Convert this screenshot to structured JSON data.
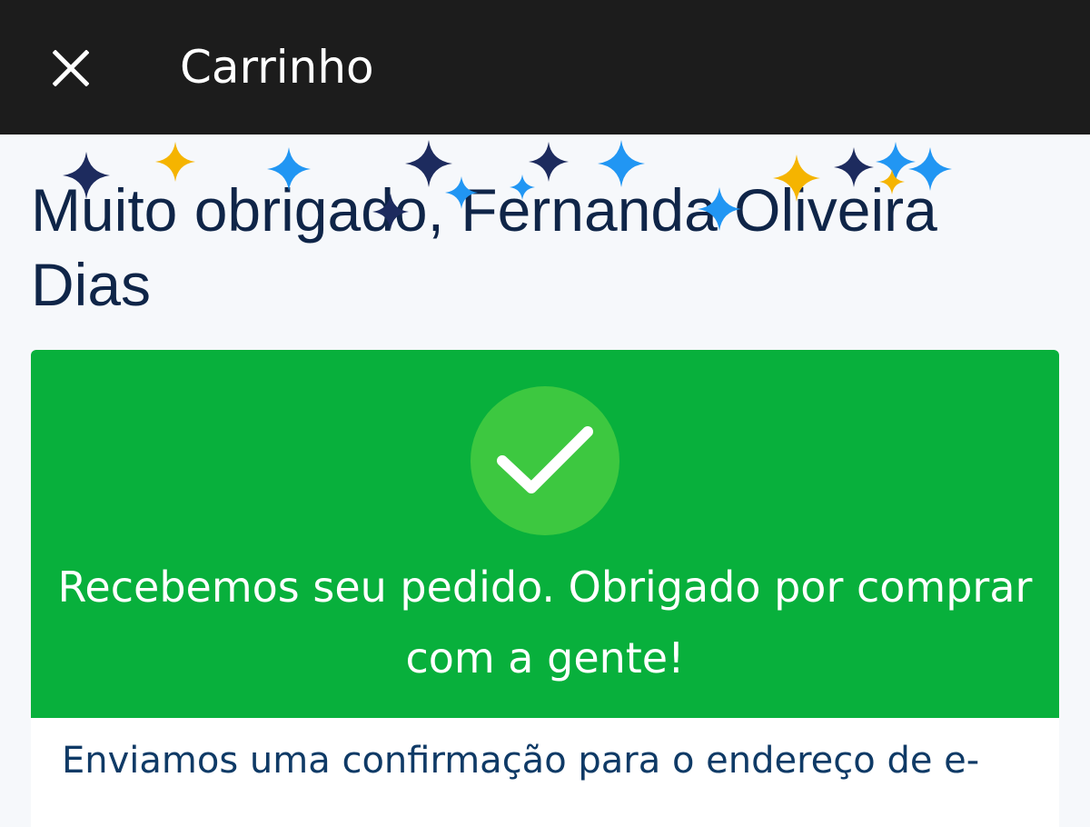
{
  "header": {
    "close_icon": "close-icon",
    "title": "Carrinho"
  },
  "greeting": {
    "text": "Muito obrigado, Fernanda Oliveira Dias"
  },
  "success": {
    "icon": "check-icon",
    "message": "Recebemos seu pedido. Obrigado por comprar com a gente!"
  },
  "confirmation": {
    "text": "Enviamos uma confirmação para o endereço de e-"
  },
  "colors": {
    "topbar": "#1c1c1c",
    "success_green": "#08b03c",
    "check_circle": "#3dc840",
    "heading": "#0f2548",
    "confetti_navy": "#1d2b5e",
    "confetti_blue": "#2196f3",
    "confetti_gold": "#f5b400"
  }
}
